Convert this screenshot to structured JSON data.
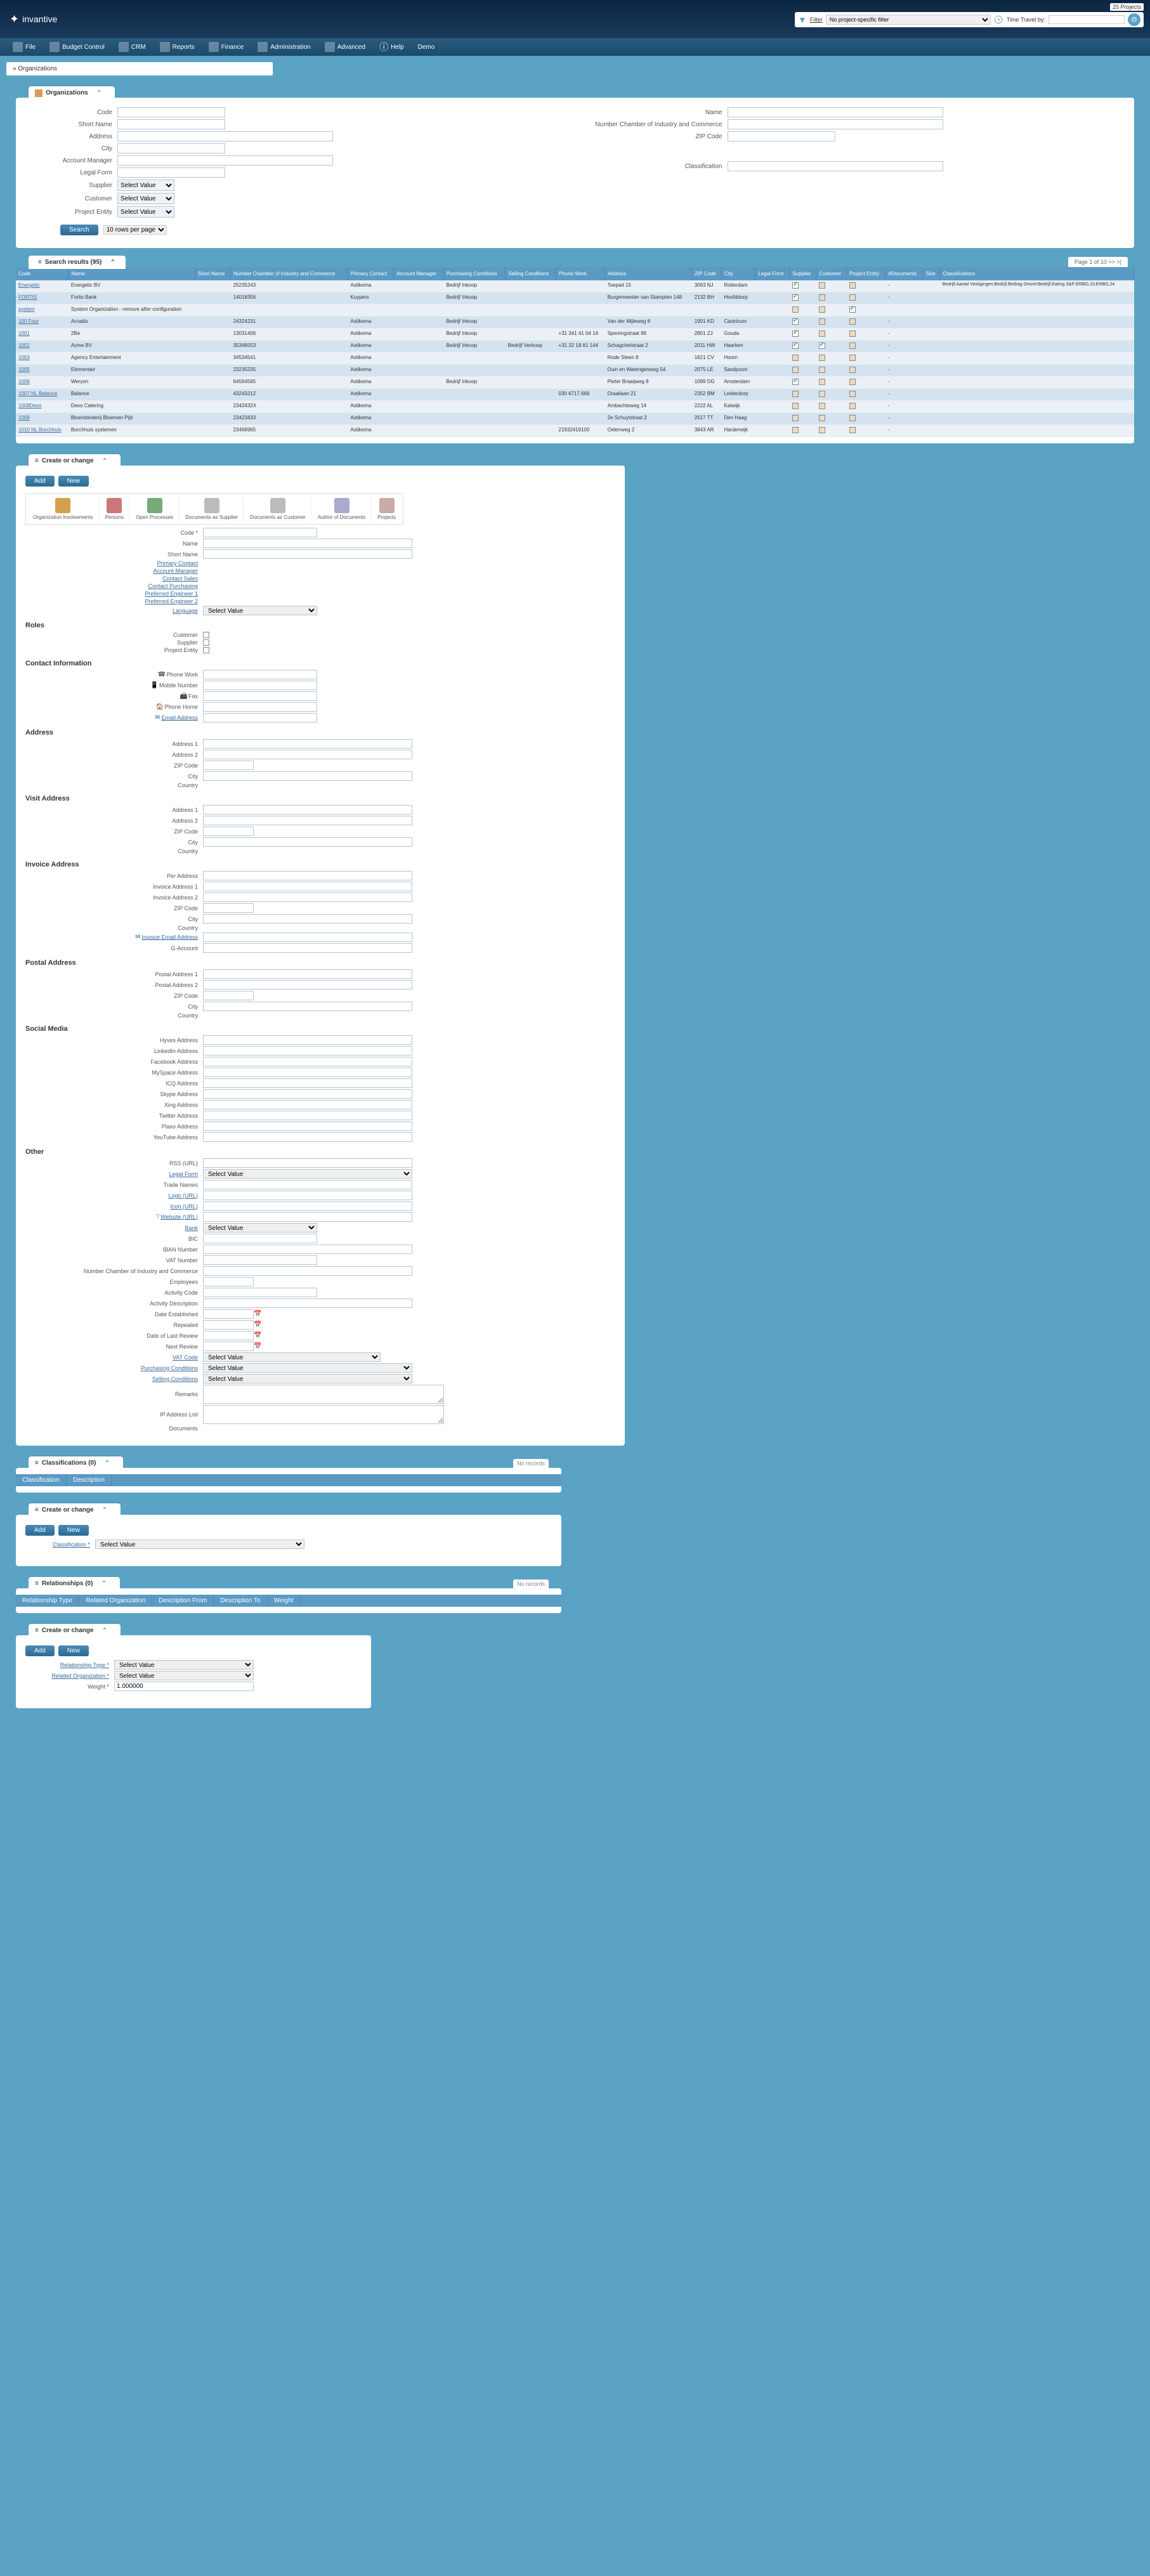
{
  "header": {
    "brand": "invantive",
    "projects_count": "25 Projects",
    "filter_label": "Filter",
    "filter_value": "No project-specific filter",
    "time_label": "Time Travel by:"
  },
  "menu": {
    "file": "File",
    "budget": "Budget Control",
    "crm": "CRM",
    "reports": "Reports",
    "finance": "Finance",
    "admin": "Administration",
    "advanced": "Advanced",
    "help": "Help",
    "demo": "Demo"
  },
  "breadcrumb": "Organizations",
  "search_panel": {
    "title": "Organizations",
    "fields": {
      "code": "Code",
      "name": "Name",
      "short_name": "Short Name",
      "chamber": "Number Chamber of Industry and Commerce",
      "address": "Address",
      "zip": "ZIP Code",
      "city": "City",
      "account_manager": "Account Manager",
      "legal_form": "Legal Form",
      "classification": "Classification",
      "supplier": "Supplier",
      "customer": "Customer",
      "project_entity": "Project Entity"
    },
    "select_value": "Select Value",
    "search_btn": "Search",
    "rows_per_page": "10 rows per page"
  },
  "results": {
    "title": "Search results (95)",
    "pager": "Page 1 of 10 >> >|",
    "columns": [
      "Code",
      "Name",
      "Short Name",
      "Number Chamber of Industry and Commerce",
      "Primary Contact",
      "Account Manager",
      "Purchasing Conditions",
      "Selling Conditions",
      "Phone Work",
      "Address",
      "ZIP Code",
      "City",
      "Legal Form",
      "Supplier",
      "Customer",
      "Project Entity",
      "#Documents",
      "Size",
      "Classifications"
    ],
    "rows": [
      {
        "code": "Energetic",
        "name": "Energetic BV",
        "short": "",
        "chamber": "25235243",
        "contact": "Astikema",
        "manager": "",
        "purch": "Bedrijf Inkoop",
        "sell": "",
        "phone": "",
        "address": "Toepad 15",
        "zip": "3063 NJ",
        "city": "Rotterdam",
        "legal": "",
        "sup": "on",
        "cust": "partial",
        "ent": "partial",
        "docs": "-",
        "size": "",
        "class": "Bedrijf,Aantal Vestigingen;Bedrijf,Bedrag Omzet;Bedrijf,Rating S&P;ERBO,10;ERBO,24"
      },
      {
        "code": "FORTIS",
        "name": "Fortis Bank",
        "short": "",
        "chamber": "14018356",
        "contact": "Kuypers",
        "manager": "",
        "purch": "Bedrijf Inkoop",
        "sell": "",
        "phone": "",
        "address": "Burgemeester van Stampten 148",
        "zip": "2132 BH",
        "city": "Hoofddorp",
        "legal": "",
        "sup": "on",
        "cust": "partial",
        "ent": "partial",
        "docs": "-",
        "size": "",
        "class": ""
      },
      {
        "code": "system",
        "name": "System Organization - remove after configuration",
        "short": "",
        "chamber": "",
        "contact": "",
        "manager": "",
        "purch": "",
        "sell": "",
        "phone": "",
        "address": "",
        "zip": "",
        "city": "",
        "legal": "",
        "sup": "partial",
        "cust": "partial",
        "ent": "on",
        "docs": "",
        "size": "",
        "class": ""
      },
      {
        "code": "100 Four",
        "name": "Arcadis",
        "short": "",
        "chamber": "24324231",
        "contact": "Astikema",
        "manager": "",
        "purch": "Bedrijf Inkoop",
        "sell": "",
        "phone": "",
        "address": "Van der Mijleweg 8",
        "zip": "1901 KD",
        "city": "Castricum",
        "legal": "",
        "sup": "on",
        "cust": "partial",
        "ent": "partial",
        "docs": "-",
        "size": "",
        "class": ""
      },
      {
        "code": "1001",
        "name": "2Be",
        "short": "",
        "chamber": "13031406",
        "contact": "Astikema",
        "manager": "",
        "purch": "Bedrijf Inkoop",
        "sell": "",
        "phone": "+31 341 41 04 14",
        "address": "Sperringstraat 99",
        "zip": "2801 ZJ",
        "city": "Gouda",
        "legal": "",
        "sup": "on",
        "cust": "partial",
        "ent": "partial",
        "docs": "-",
        "size": "",
        "class": ""
      },
      {
        "code": "1002",
        "name": "Acme BV",
        "short": "",
        "chamber": "35346553",
        "contact": "Astikema",
        "manager": "",
        "purch": "Bedrijf Inkoop",
        "sell": "Bedrijf Verkoop",
        "phone": "+31 32 18 81 144",
        "address": "Schagchelstraat 2",
        "zip": "2011 HW",
        "city": "Haarlem",
        "legal": "",
        "sup": "on",
        "cust": "on",
        "ent": "partial",
        "docs": "-",
        "size": "",
        "class": ""
      },
      {
        "code": "1003",
        "name": "Agency Entertainment",
        "short": "",
        "chamber": "34534541",
        "contact": "Astikema",
        "manager": "",
        "purch": "",
        "sell": "",
        "phone": "",
        "address": "Rode Steen 8",
        "zip": "1621 CV",
        "city": "Hoorn",
        "legal": "",
        "sup": "partial",
        "cust": "partial",
        "ent": "partial",
        "docs": "-",
        "size": "",
        "class": ""
      },
      {
        "code": "1005",
        "name": "Elementair",
        "short": "",
        "chamber": "23235235",
        "contact": "Astikema",
        "manager": "",
        "purch": "",
        "sell": "",
        "phone": "",
        "address": "Duin en Waterigenweg 54",
        "zip": "2075 LE",
        "city": "Sandpoort",
        "legal": "",
        "sup": "partial",
        "cust": "partial",
        "ent": "partial",
        "docs": "-",
        "size": "",
        "class": ""
      },
      {
        "code": "1006",
        "name": "Weryon",
        "short": "",
        "chamber": "64564565",
        "contact": "Astikema",
        "manager": "",
        "purch": "Bedrijf Inkoop",
        "sell": "",
        "phone": "",
        "address": "Pieter Braaijweg 8",
        "zip": "1099 DG",
        "city": "Amsterdam",
        "legal": "",
        "sup": "on",
        "cust": "partial",
        "ent": "partial",
        "docs": "-",
        "size": "",
        "class": ""
      },
      {
        "code": "1007 NL Balance",
        "name": "Balance",
        "short": "",
        "chamber": "43243212",
        "contact": "Astikema",
        "manager": "",
        "purch": "",
        "sell": "",
        "phone": "030 6717.666",
        "address": "Draailaan 21",
        "zip": "2352 BM",
        "city": "Leiderdorp",
        "legal": "",
        "sup": "partial",
        "cust": "partial",
        "ent": "partial",
        "docs": "-",
        "size": "",
        "class": ""
      },
      {
        "code": "1008Devo",
        "name": "Devo Catering",
        "short": "",
        "chamber": "2342432X",
        "contact": "Astikema",
        "manager": "",
        "purch": "",
        "sell": "",
        "phone": "",
        "address": "Ambachtsweg 14",
        "zip": "2222 AL",
        "city": "Katwijk",
        "legal": "",
        "sup": "partial",
        "cust": "partial",
        "ent": "partial",
        "docs": "-",
        "size": "",
        "class": ""
      },
      {
        "code": "1009",
        "name": "Bloembinderij Bloemen Pijtl",
        "short": "",
        "chamber": "23423433",
        "contact": "Astikema",
        "manager": "",
        "purch": "",
        "sell": "",
        "phone": "",
        "address": "2e Schuytstraat 2",
        "zip": "2517 TT",
        "city": "Den Haag",
        "legal": "",
        "sup": "partial",
        "cust": "partial",
        "ent": "partial",
        "docs": "-",
        "size": "",
        "class": ""
      },
      {
        "code": "1010 NL Borchhuis",
        "name": "Borchhuis systemen",
        "short": "",
        "chamber": "23466965",
        "contact": "Astikema",
        "manager": "",
        "purch": "",
        "sell": "",
        "phone": "21932419100",
        "address": "Oelenweg 2",
        "zip": "3843 AR",
        "city": "Harderwijk",
        "legal": "",
        "sup": "partial",
        "cust": "partial",
        "ent": "partial",
        "docs": "-",
        "size": "",
        "class": ""
      }
    ]
  },
  "detail": {
    "tab_title": "Create or change",
    "add": "Add",
    "new": "New",
    "tools": {
      "inv": "Organization Involvements",
      "persons": "Persons",
      "processes": "Open Processes",
      "docs_sup": "Documents as Supplier",
      "docs_cust": "Documents as Customer",
      "author": "Author of Documents",
      "projects": "Projects"
    },
    "labels": {
      "code": "Code *",
      "name": "Name",
      "short_name": "Short Name",
      "primary_contact": "Primary Contact",
      "account_manager": "Account Manager",
      "contact_sales": "Contact Sales",
      "contact_purchasing": "Contact Purchasing",
      "pref_eng1": "Preferred Engineer 1",
      "pref_eng2": "Preferred Engineer 2",
      "language": "Language"
    },
    "sections": {
      "roles": "Roles",
      "roles_customer": "Customer",
      "roles_supplier": "Supplier",
      "roles_entity": "Project Entity",
      "contact": "Contact Information",
      "phone_work": "Phone Work",
      "mobile": "Mobile Number",
      "fax": "Fax",
      "phone_home": "Phone Home",
      "email": "Email Address",
      "address": "Address",
      "addr1": "Address 1",
      "addr2": "Address 2",
      "zip": "ZIP Code",
      "city": "City",
      "country": "Country",
      "visit": "Visit Address",
      "invoice": "Invoice Address",
      "per_address": "Per Address",
      "inv_addr1": "Invoice Address 1",
      "inv_addr2": "Invoice Address 2",
      "inv_email": "Invoice Email Address",
      "g_account": "G-Account",
      "postal": "Postal Address",
      "postal1": "Postal Address 1",
      "postal2": "Postal Address 2",
      "social": "Social Media",
      "hyves": "Hyves Address",
      "linkedin": "LinkedIn Address",
      "facebook": "Facebook Address",
      "myspace": "MySpace Address",
      "icq": "ICQ Address",
      "skype": "Skype Address",
      "xing": "Xing Address",
      "twitter": "Twitter Address",
      "plaxo": "Plaxo Address",
      "youtube": "YouTube Address",
      "other": "Other",
      "rss": "RSS (URL)",
      "legal_form": "Legal Form",
      "trade_names": "Trade Names",
      "logo": "Logo (URL)",
      "icon": "Icon (URL)",
      "website": "Website (URL)",
      "bank": "Bank",
      "bic": "BIC",
      "iban": "IBAN Number",
      "vat": "VAT Number",
      "chamber": "Number Chamber of Industry and Commerce",
      "employees": "Employees",
      "activity_code": "Activity Code",
      "activity_desc": "Activity Description",
      "date_est": "Date Established",
      "repealed": "Repealed",
      "date_review": "Date of Last Review",
      "next_review": "Next Review",
      "vat_code": "VAT Code",
      "purch_cond": "Purchasing Conditions",
      "sell_cond": "Selling Conditions",
      "remarks": "Remarks",
      "ip_list": "IP Address List",
      "documents": "Documents"
    }
  },
  "class_panel": {
    "title": "Classifications (0)",
    "no_records": "No records",
    "cols": {
      "class": "Classification",
      "desc": "Description"
    },
    "create": "Create or change",
    "classification": "Classification *"
  },
  "rel_panel": {
    "title": "Relationships (0)",
    "no_records": "No records",
    "cols": {
      "type": "Relationship Type",
      "related": "Related Organization",
      "desc_from": "Description From",
      "desc_to": "Description To",
      "weight": "Weight"
    },
    "create": "Create or change",
    "rel_type": "Relationship Type *",
    "rel_org": "Related Organization *",
    "weight": "Weight *",
    "weight_val": "1.000000"
  },
  "common": {
    "select_value": "Select Value"
  }
}
